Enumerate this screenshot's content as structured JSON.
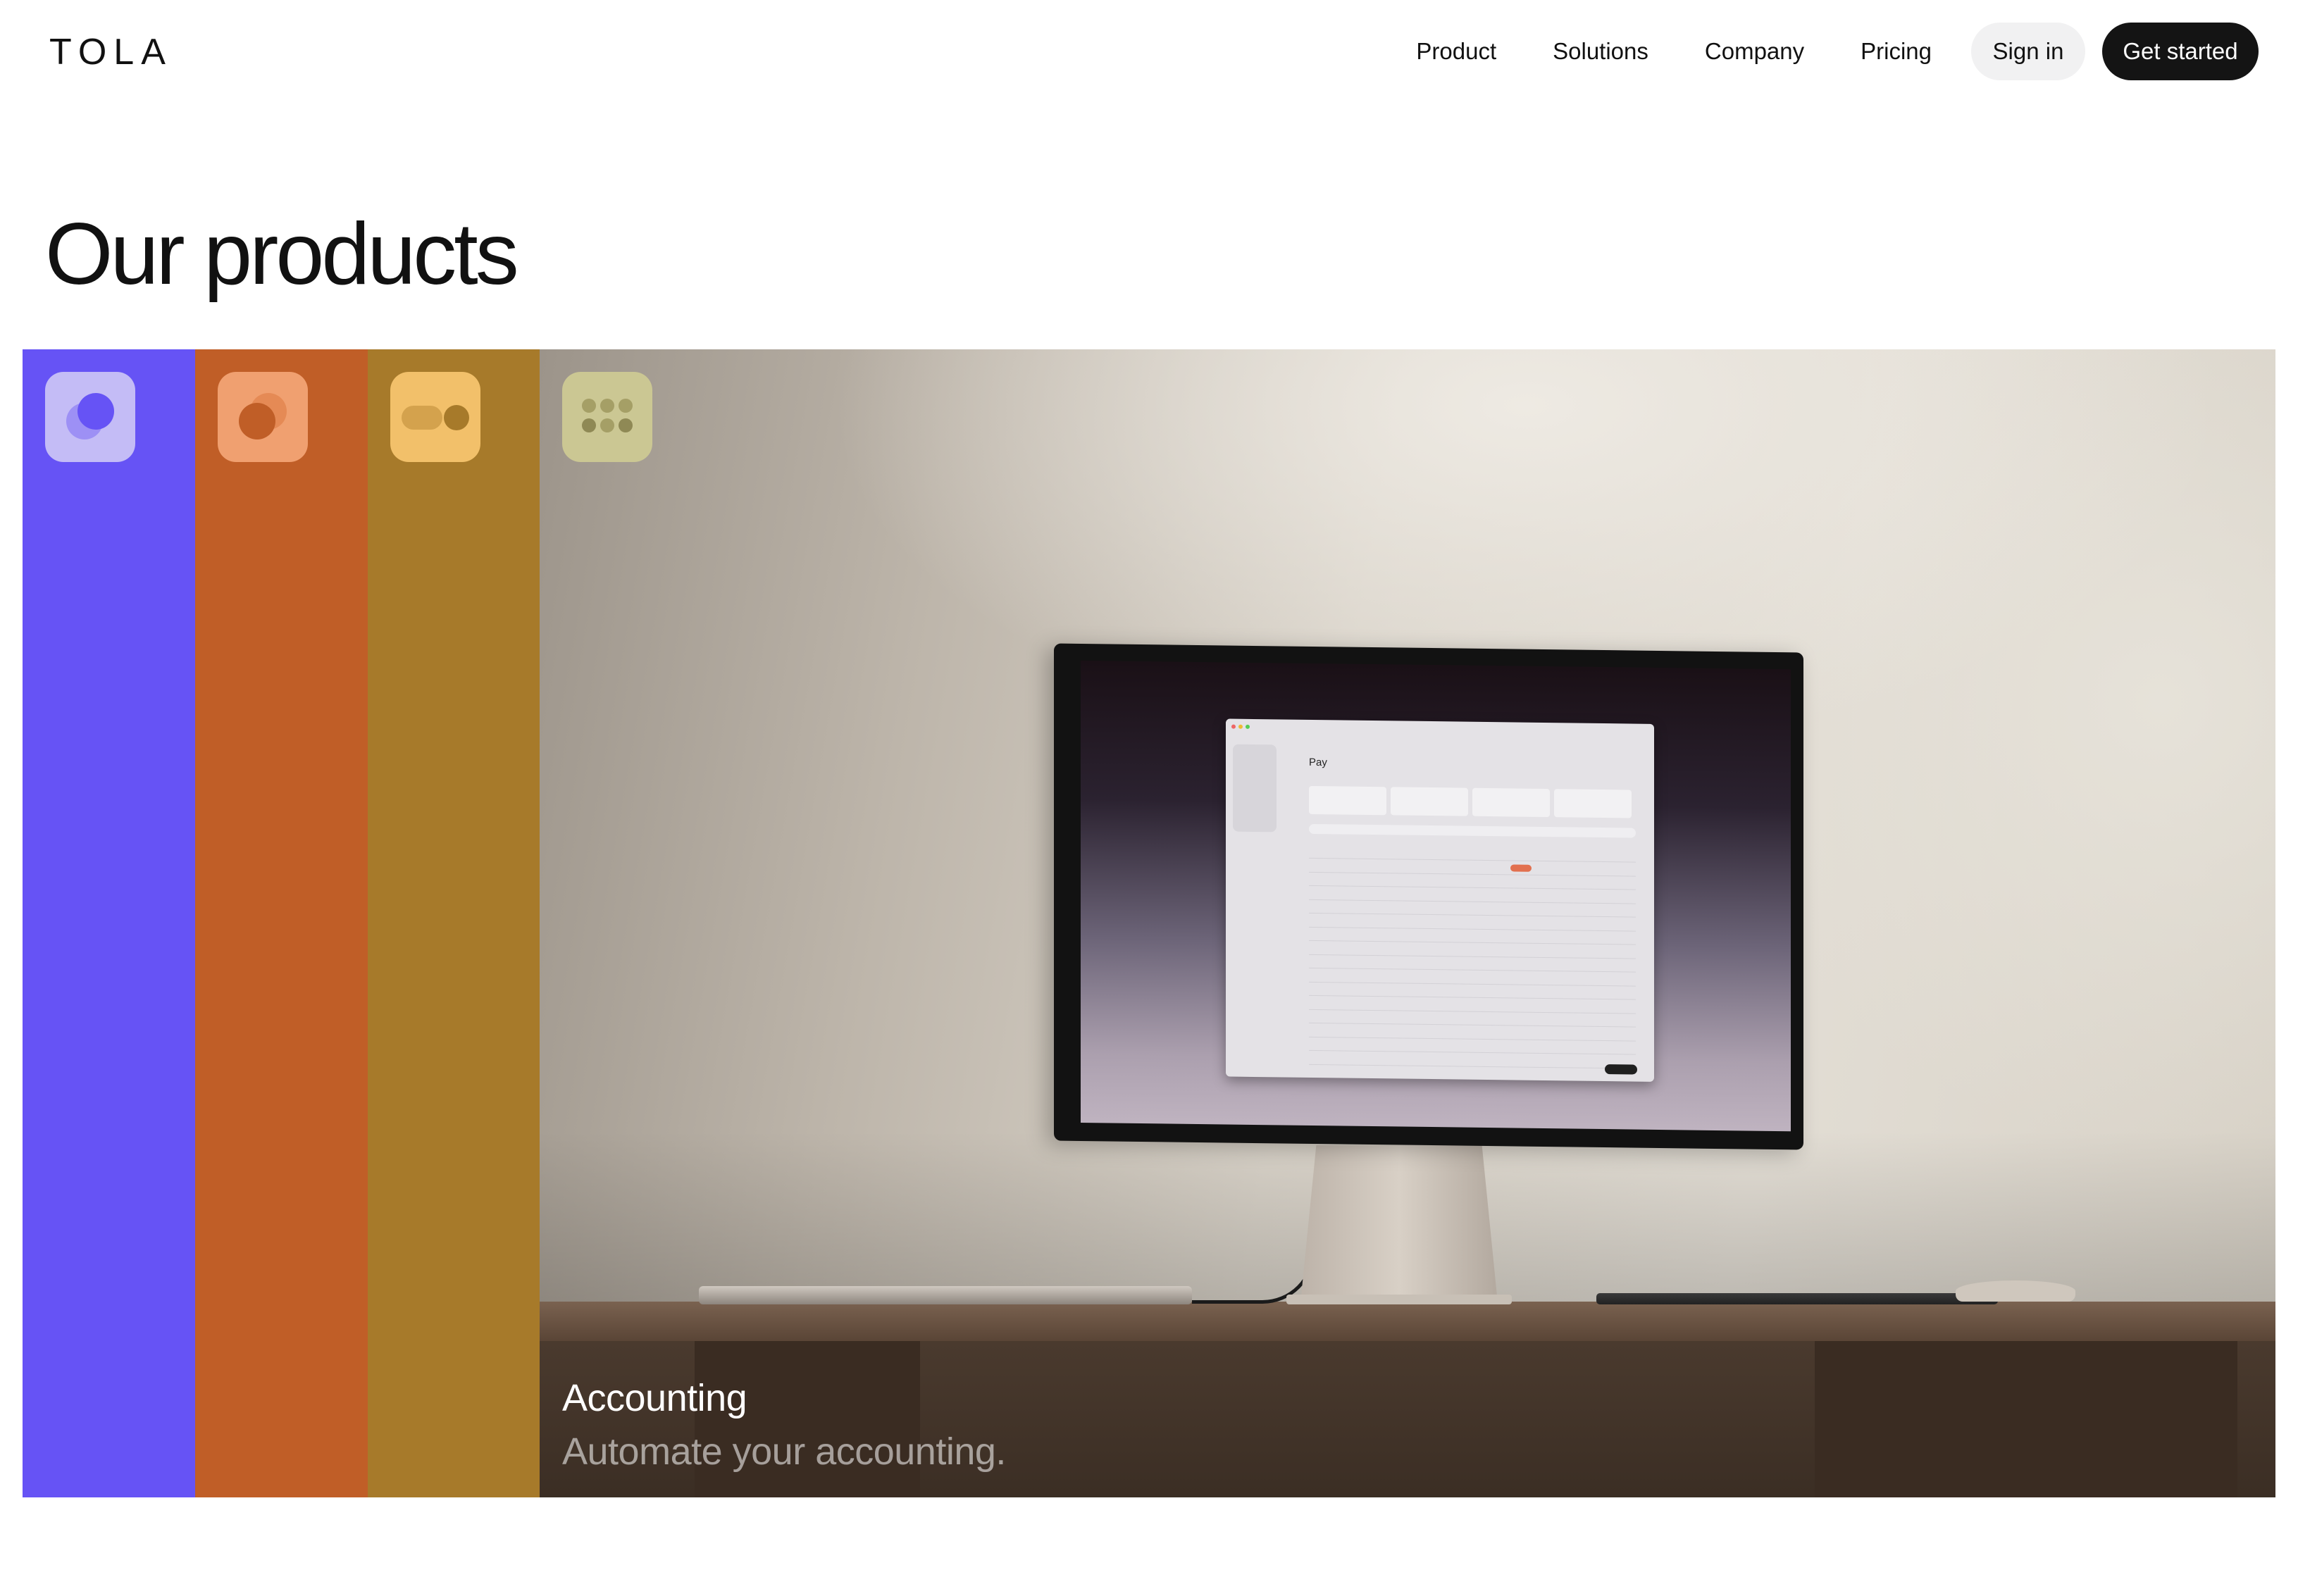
{
  "header": {
    "logo": "TOLA",
    "nav": [
      "Product",
      "Solutions",
      "Company",
      "Pricing"
    ],
    "sign_in": "Sign in",
    "get_started": "Get started"
  },
  "main": {
    "title": "Our products",
    "products": [
      {
        "color": "#6653f5",
        "icon": "overlapping-circles-icon",
        "icon_bg": "#c4bcf6"
      },
      {
        "color": "#c05e27",
        "icon": "overlapping-circles-icon",
        "icon_bg": "#f0a070"
      },
      {
        "color": "#a77a2a",
        "icon": "toggle-pill-icon",
        "icon_bg": "#f2c06a"
      },
      {
        "color": "#8c8464",
        "icon": "dot-grid-icon",
        "icon_bg": "#cbc793"
      }
    ],
    "featured": {
      "title": "Accounting",
      "subtitle": "Automate your accounting.",
      "screen_title": "Pay"
    }
  }
}
